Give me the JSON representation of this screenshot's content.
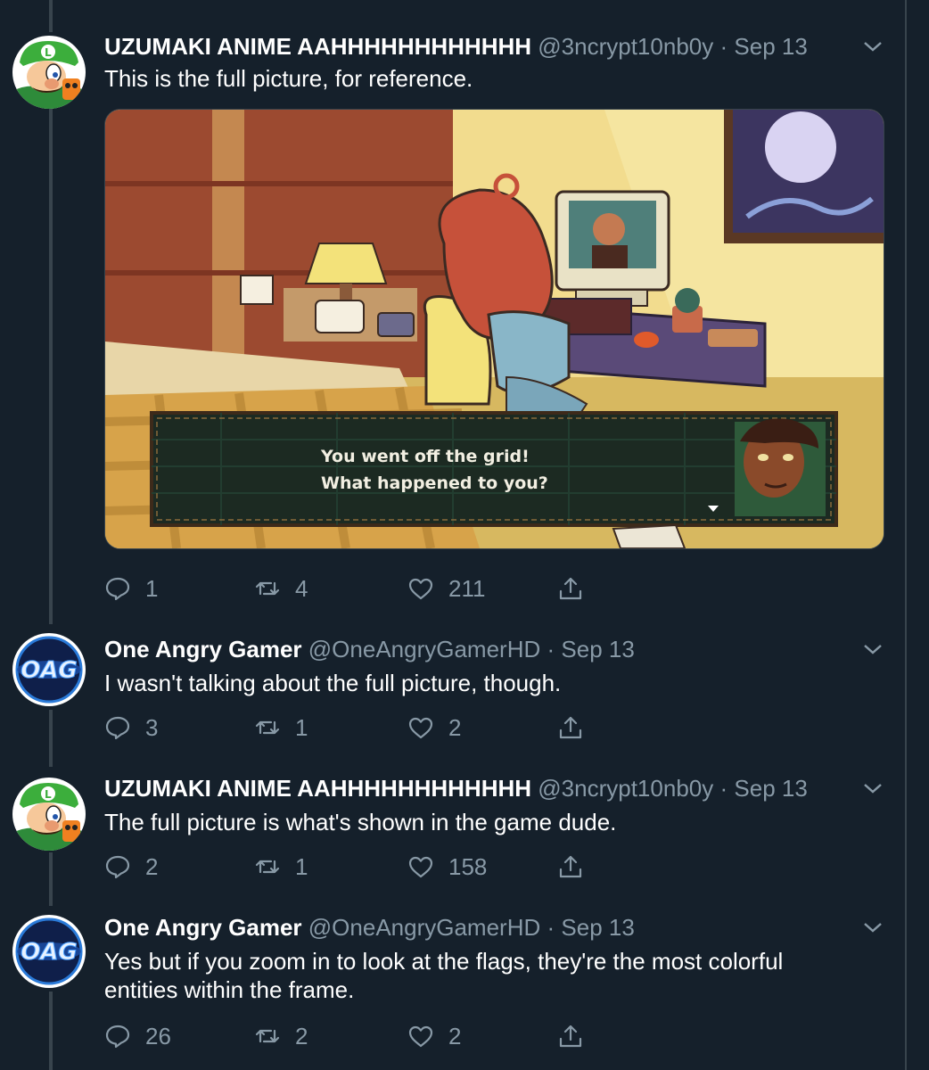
{
  "tweets": [
    {
      "name": "UZUMAKI ANIME AAHHHHHHHHHHHH",
      "handle": "@3ncrypt10nb0y",
      "dot": "·",
      "date": "Sep 13",
      "text": "This is the full picture, for reference.",
      "replies": "1",
      "retweets": "4",
      "likes": "211",
      "avatar": "luigi-avatar"
    },
    {
      "name": "One Angry Gamer",
      "handle": "@OneAngryGamerHD",
      "dot": "·",
      "date": "Sep 13",
      "text": "I wasn't talking about the full picture, though.",
      "replies": "3",
      "retweets": "1",
      "likes": "2",
      "avatar": "oag-logo-avatar",
      "logo_text": "OAG"
    },
    {
      "name": "UZUMAKI ANIME AAHHHHHHHHHHHH",
      "handle": "@3ncrypt10nb0y",
      "dot": "·",
      "date": "Sep 13",
      "text": "The full picture is what's shown in the game dude.",
      "replies": "2",
      "retweets": "1",
      "likes": "158",
      "avatar": "luigi-avatar"
    },
    {
      "name": "One Angry Gamer",
      "handle": "@OneAngryGamerHD",
      "dot": "·",
      "date": "Sep 13",
      "text": "Yes but if you zoom in to look at the flags, they're the most colorful entities within the frame.",
      "replies": "26",
      "retweets": "2",
      "likes": "2",
      "avatar": "oag-logo-avatar",
      "logo_text": "OAG"
    }
  ],
  "media": {
    "dialog_line1": "You went off the grid!",
    "dialog_line2": "What happened to you?"
  },
  "colors": {
    "background": "#15202b",
    "secondary_text": "#8899a6",
    "divider": "#38444d"
  }
}
